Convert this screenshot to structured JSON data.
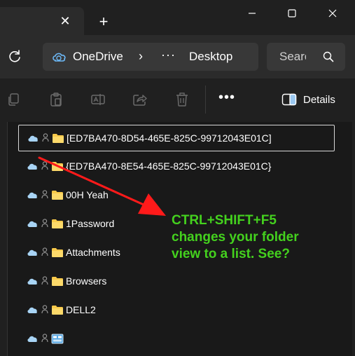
{
  "titlebar": {
    "tab_close_glyph": "✕",
    "new_tab_glyph": "+"
  },
  "window_controls": [
    "minimize-icon",
    "maximize-icon",
    "close-icon"
  ],
  "address_bar": {
    "breadcrumb": [
      "OneDrive",
      "Desktop"
    ],
    "separator": "›",
    "overflow": "···",
    "icons": [
      "refresh-icon",
      "onedrive-icon"
    ]
  },
  "search": {
    "placeholder": "Search"
  },
  "command_bar": {
    "icons": [
      "copy-icon",
      "paste-icon",
      "rename-icon",
      "share-icon",
      "delete-icon"
    ],
    "more": "•••",
    "details_label": "Details"
  },
  "file_list": {
    "items": [
      {
        "name": "[ED7BA470-8D54-465E-825C-99712043E01C]",
        "selected": true,
        "icon": "folder-icon",
        "status": "cloud-icon"
      },
      {
        "name": "{ED7BA470-8E54-465E-825C-99712043E01C}",
        "selected": false,
        "icon": "folder-icon",
        "status": "cloud-icon"
      },
      {
        "name": "00H Yeah",
        "selected": false,
        "icon": "folder-icon",
        "status": "cloud-icon"
      },
      {
        "name": "1Password",
        "selected": false,
        "icon": "folder-icon",
        "status": "cloud-icon"
      },
      {
        "name": "Attachments",
        "selected": false,
        "icon": "folder-icon",
        "status": "cloud-icon"
      },
      {
        "name": "Browsers",
        "selected": false,
        "icon": "folder-icon",
        "status": "cloud-icon"
      },
      {
        "name": "DELL2",
        "selected": false,
        "icon": "folder-icon",
        "status": "cloud-icon"
      },
      {
        "name": "",
        "selected": false,
        "icon": "control-panel-icon",
        "status": "cloud-icon"
      }
    ]
  },
  "annotation": {
    "text": "CTRL+SHIFT+F5\nchanges your folder\nview to a list. See?",
    "color": "#44d11e",
    "arrow_color": "#ff1a1a"
  }
}
